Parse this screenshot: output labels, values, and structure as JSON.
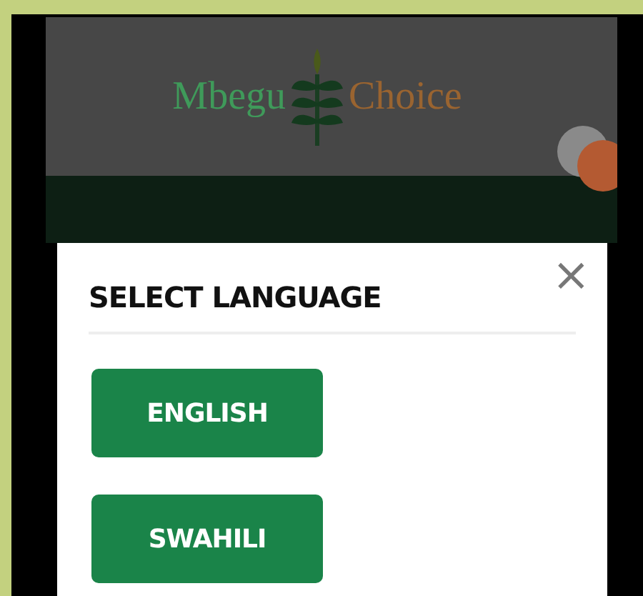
{
  "header": {
    "logo_left": "Mbegu",
    "logo_right": "Choice"
  },
  "modal": {
    "title": "SELECT LANGUAGE",
    "close": "×",
    "languages": [
      {
        "label": "ENGLISH"
      },
      {
        "label": "SWAHILI"
      }
    ]
  }
}
